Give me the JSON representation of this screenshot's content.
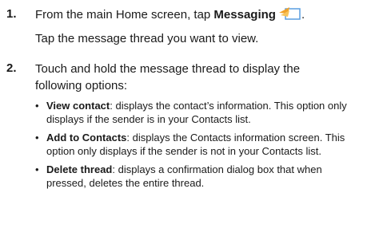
{
  "steps": [
    {
      "number": "1.",
      "text_before": "From the main Home screen, tap ",
      "bold": "Messaging",
      "icon": "messaging-icon",
      "after_icon": ".",
      "followup": "Tap the message thread you want to view."
    },
    {
      "number": "2.",
      "text": "Touch and hold the message thread to display the following options:"
    }
  ],
  "options": [
    {
      "term": "View contact",
      "desc": ": displays the contact’s information. This option only displays if the sender is in your Contacts list."
    },
    {
      "term": "Add to Contacts",
      "desc": ": displays the Contacts information screen. This option only displays if the sender is not in your Contacts list."
    },
    {
      "term": "Delete thread",
      "desc": ": displays a confirmation dialog box that when pressed, deletes the entire thread."
    }
  ],
  "colors": {
    "icon_orange": "#f0a22a",
    "icon_blue": "#5a9ee0"
  }
}
